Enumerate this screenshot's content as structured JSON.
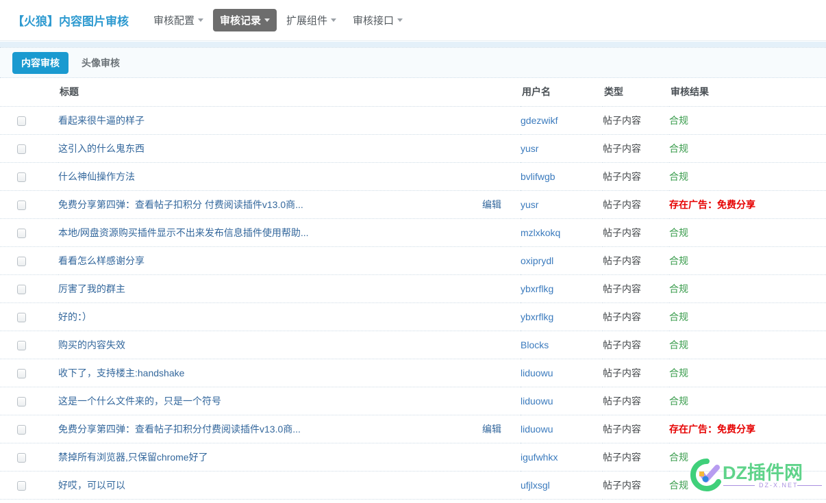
{
  "header": {
    "brand": "【火狼】内容图片审核",
    "nav": [
      {
        "label": "审核配置",
        "active": false,
        "icon": "chevron-down-icon"
      },
      {
        "label": "审核记录",
        "active": true,
        "icon": "chevron-down-icon"
      },
      {
        "label": "扩展组件",
        "active": false,
        "icon": "chevron-down-icon"
      },
      {
        "label": "审核接口",
        "active": false,
        "icon": "chevron-down-icon"
      }
    ]
  },
  "tabs": [
    {
      "label": "内容审核",
      "active": true
    },
    {
      "label": "头像审核",
      "active": false
    }
  ],
  "table": {
    "columns": [
      "",
      "标题",
      "用户名",
      "类型",
      "审核结果"
    ],
    "edit_label": "编辑",
    "rows": [
      {
        "title": "看起来很牛逼的样子",
        "edit": false,
        "user": "gdezwikf",
        "type": "帖子内容",
        "result": "合规",
        "status": "ok"
      },
      {
        "title": "这引入的什么鬼东西",
        "edit": false,
        "user": "yusr",
        "type": "帖子内容",
        "result": "合规",
        "status": "ok"
      },
      {
        "title": "什么神仙操作方法",
        "edit": false,
        "user": "bvlifwgb",
        "type": "帖子内容",
        "result": "合规",
        "status": "ok"
      },
      {
        "title": "免费分享第四弹：查看帖子扣积分 付费阅读插件v13.0商...",
        "edit": true,
        "user": "yusr",
        "type": "帖子内容",
        "result": "存在广告：免费分享",
        "status": "bad"
      },
      {
        "title": "本地/网盘资源购买插件显示不出来发布信息插件使用帮助...",
        "edit": false,
        "user": "mzlxkokq",
        "type": "帖子内容",
        "result": "合规",
        "status": "ok"
      },
      {
        "title": "看看怎么样感谢分享",
        "edit": false,
        "user": "oxiprydl",
        "type": "帖子内容",
        "result": "合规",
        "status": "ok"
      },
      {
        "title": "厉害了我的群主",
        "edit": false,
        "user": "ybxrflkg",
        "type": "帖子内容",
        "result": "合规",
        "status": "ok"
      },
      {
        "title": "好的：）",
        "edit": false,
        "user": "ybxrflkg",
        "type": "帖子内容",
        "result": "合规",
        "status": "ok"
      },
      {
        "title": "购买的内容失效",
        "edit": false,
        "user": "Blocks",
        "type": "帖子内容",
        "result": "合规",
        "status": "ok"
      },
      {
        "title": "收下了，支持楼主:handshake",
        "edit": false,
        "user": "liduowu",
        "type": "帖子内容",
        "result": "合规",
        "status": "ok"
      },
      {
        "title": "这是一个什么文件来的，只是一个符号",
        "edit": false,
        "user": "liduowu",
        "type": "帖子内容",
        "result": "合规",
        "status": "ok"
      },
      {
        "title": "免费分享第四弹：查看帖子扣积分付费阅读插件v13.0商...",
        "edit": true,
        "user": "liduowu",
        "type": "帖子内容",
        "result": "存在广告：免费分享",
        "status": "bad"
      },
      {
        "title": "禁掉所有浏览器,只保留chrome好了",
        "edit": false,
        "user": "igufwhkx",
        "type": "帖子内容",
        "result": "合规",
        "status": "ok"
      },
      {
        "title": "好哎，可以可以",
        "edit": false,
        "user": "ufjlxsgl",
        "type": "帖子内容",
        "result": "合规",
        "status": "ok"
      }
    ]
  },
  "watermark": {
    "text": "DZ插件网",
    "sub": "DZ-X.NET"
  },
  "colors": {
    "brand": "#2e9ad0",
    "tab_active": "#1a9ad0",
    "nav_active": "#6d6d6d",
    "link": "#33679c",
    "user_link": "#3a7abd",
    "result_ok": "#3a9c4d",
    "result_bad": "#e60000",
    "strip": "#e4f0f9",
    "tabbar_bg": "#f7fbfd"
  }
}
